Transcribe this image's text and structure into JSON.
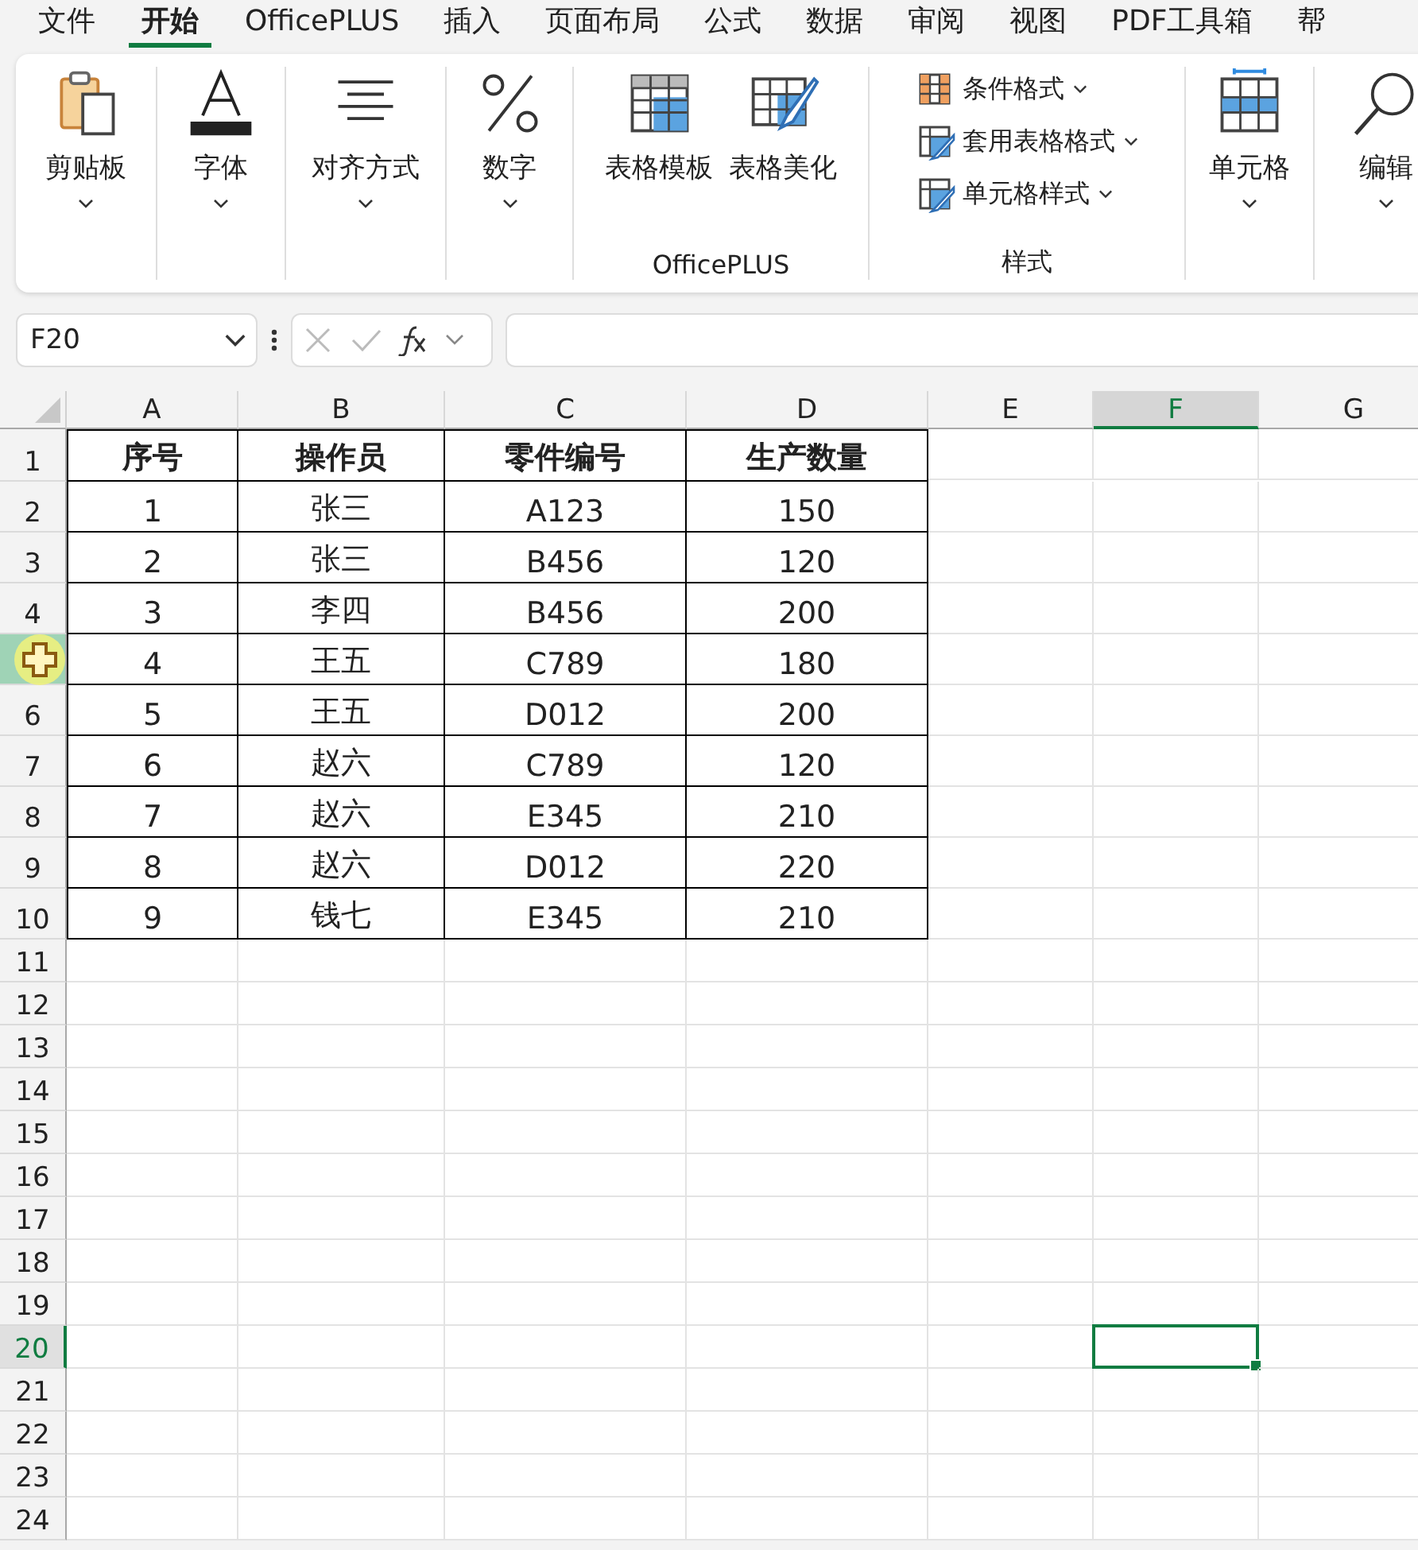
{
  "menu_tabs": [
    {
      "label": "文件",
      "selected": false
    },
    {
      "label": "开始",
      "selected": true
    },
    {
      "label": "OfficePLUS",
      "selected": false
    },
    {
      "label": "插入",
      "selected": false
    },
    {
      "label": "页面布局",
      "selected": false
    },
    {
      "label": "公式",
      "selected": false
    },
    {
      "label": "数据",
      "selected": false
    },
    {
      "label": "审阅",
      "selected": false
    },
    {
      "label": "视图",
      "selected": false
    },
    {
      "label": "PDF工具箱",
      "selected": false
    },
    {
      "label": "帮",
      "selected": false
    }
  ],
  "ribbon": {
    "groups": [
      {
        "buttons": [
          {
            "label": "剪贴板",
            "kind": "large",
            "dropdown": true
          }
        ]
      },
      {
        "buttons": [
          {
            "label": "字体",
            "kind": "large",
            "dropdown": true
          }
        ]
      },
      {
        "buttons": [
          {
            "label": "对齐方式",
            "kind": "large",
            "dropdown": true
          }
        ]
      },
      {
        "buttons": [
          {
            "label": "数字",
            "kind": "large",
            "dropdown": true
          }
        ]
      },
      {
        "label": "OfficePLUS",
        "buttons": [
          {
            "label": "表格模板",
            "kind": "large",
            "dropdown": false
          },
          {
            "label": "表格美化",
            "kind": "large",
            "dropdown": false
          }
        ]
      },
      {
        "label": "样式",
        "buttons": [
          {
            "label": "条件格式",
            "kind": "small",
            "dropdown": true
          },
          {
            "label": "套用表格格式",
            "kind": "small",
            "dropdown": true
          },
          {
            "label": "单元格样式",
            "kind": "small",
            "dropdown": true
          }
        ]
      },
      {
        "buttons": [
          {
            "label": "单元格",
            "kind": "large",
            "dropdown": true
          }
        ]
      },
      {
        "buttons": [
          {
            "label": "编辑",
            "kind": "large",
            "dropdown": true
          }
        ]
      }
    ]
  },
  "formula_bar": {
    "name_box": "F20"
  },
  "sheet": {
    "columns": [
      {
        "label": "A",
        "selected": false
      },
      {
        "label": "B",
        "selected": false
      },
      {
        "label": "C",
        "selected": false
      },
      {
        "label": "D",
        "selected": false
      },
      {
        "label": "E",
        "selected": false
      },
      {
        "label": "F",
        "selected": true
      },
      {
        "label": "G",
        "selected": false
      }
    ],
    "rows": [
      {
        "number": "1",
        "selected": false,
        "hovered": false,
        "header": true,
        "cells": [
          "序号",
          "操作员",
          "零件编号",
          "生产数量"
        ]
      },
      {
        "number": "2",
        "selected": false,
        "hovered": false,
        "header": false,
        "cells": [
          "1",
          "张三",
          "A123",
          "150"
        ]
      },
      {
        "number": "3",
        "selected": false,
        "hovered": false,
        "header": false,
        "cells": [
          "2",
          "张三",
          "B456",
          "120"
        ]
      },
      {
        "number": "4",
        "selected": false,
        "hovered": false,
        "header": false,
        "cells": [
          "3",
          "李四",
          "B456",
          "200"
        ]
      },
      {
        "selected": false,
        "hovered": true,
        "header": false,
        "cells": [
          "4",
          "王五",
          "C789",
          "180"
        ]
      },
      {
        "number": "6",
        "selected": false,
        "hovered": false,
        "header": false,
        "cells": [
          "5",
          "王五",
          "D012",
          "200"
        ]
      },
      {
        "number": "7",
        "selected": false,
        "hovered": false,
        "header": false,
        "cells": [
          "6",
          "赵六",
          "C789",
          "120"
        ]
      },
      {
        "number": "8",
        "selected": false,
        "hovered": false,
        "header": false,
        "cells": [
          "7",
          "赵六",
          "E345",
          "210"
        ]
      },
      {
        "number": "9",
        "selected": false,
        "hovered": false,
        "header": false,
        "cells": [
          "8",
          "赵六",
          "D012",
          "220"
        ]
      },
      {
        "number": "10",
        "selected": false,
        "hovered": false,
        "header": false,
        "cells": [
          "9",
          "钱七",
          "E345",
          "210"
        ]
      },
      {
        "number": "11",
        "selected": false,
        "hovered": false
      },
      {
        "number": "12",
        "selected": false,
        "hovered": false
      },
      {
        "number": "13",
        "selected": false,
        "hovered": false
      },
      {
        "number": "14",
        "selected": false,
        "hovered": false
      },
      {
        "number": "15",
        "selected": false,
        "hovered": false
      },
      {
        "number": "16",
        "selected": false,
        "hovered": false
      },
      {
        "number": "17",
        "selected": false,
        "hovered": false
      },
      {
        "number": "18",
        "selected": false,
        "hovered": false
      },
      {
        "number": "19",
        "selected": false,
        "hovered": false
      },
      {
        "number": "20",
        "selected": true,
        "hovered": false
      },
      {
        "number": "21",
        "selected": false,
        "hovered": false
      },
      {
        "number": "22",
        "selected": false,
        "hovered": false
      },
      {
        "number": "23",
        "selected": false,
        "hovered": false
      },
      {
        "number": "24",
        "selected": false,
        "hovered": false
      }
    ]
  }
}
